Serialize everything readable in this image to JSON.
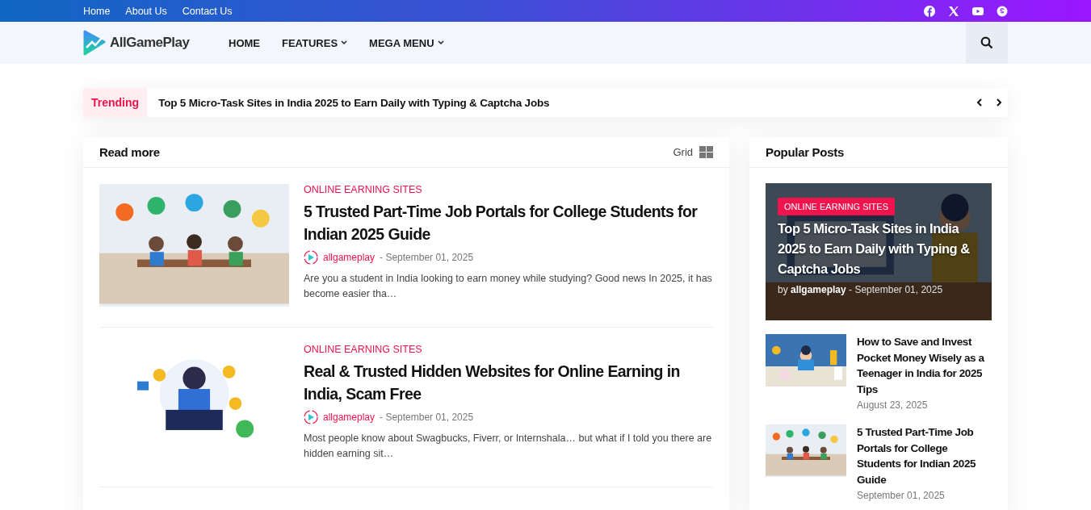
{
  "top_links": [
    "Home",
    "About Us",
    "Contact Us"
  ],
  "social": [
    {
      "kind": "facebook"
    },
    {
      "kind": "x"
    },
    {
      "kind": "youtube"
    },
    {
      "kind": "skype"
    }
  ],
  "logo": {
    "text": "AllGamePlay"
  },
  "nav": [
    {
      "label": "HOME",
      "dropdown": false
    },
    {
      "label": "FEATURES",
      "dropdown": true
    },
    {
      "label": "MEGA MENU",
      "dropdown": true
    }
  ],
  "trending": {
    "label": "Trending",
    "headline": "Top 5 Micro-Task Sites in India 2025 to Earn Daily with Typing & Captcha Jobs"
  },
  "main": {
    "title": "Read more",
    "view": "Grid",
    "posts": [
      {
        "category": "ONLINE EARNING SITES",
        "title": "5 Trusted Part-Time Job Portals for College Students for Indian 2025 Guide",
        "author": "allgameplay",
        "date": "- September 01, 2025",
        "excerpt": "Are you a student in India looking to earn money while studying? Good news In 2025, it has become easier tha…",
        "kind": "picture"
      },
      {
        "category": "ONLINE EARNING SITES",
        "title": "Real & Trusted Hidden Websites for Online Earning in India, Scam Free",
        "author": "allgameplay",
        "date": "- September 01, 2025",
        "excerpt": "Most people know about Swagbucks, Fiverr, or Internshala… but what if I told you there are hidden earning sit…",
        "kind": "picture"
      }
    ]
  },
  "sidebar": {
    "title": "Popular Posts",
    "featured": {
      "category": "ONLINE EARNING SITES",
      "title": "Top 5 Micro-Task Sites in India 2025 to Earn Daily with Typing & Captcha Jobs",
      "by": "by",
      "author": "allgameplay",
      "date": "- September 01, 2025"
    },
    "posts": [
      {
        "title": "How to Save and Invest Pocket Money Wisely as a Teenager in India for 2025 Tips",
        "date": "August 23, 2025",
        "kind": "picture"
      },
      {
        "title": "5 Trusted Part-Time Job Portals for College Students for Indian 2025 Guide",
        "date": "September 01, 2025",
        "kind": "picture"
      }
    ]
  }
}
